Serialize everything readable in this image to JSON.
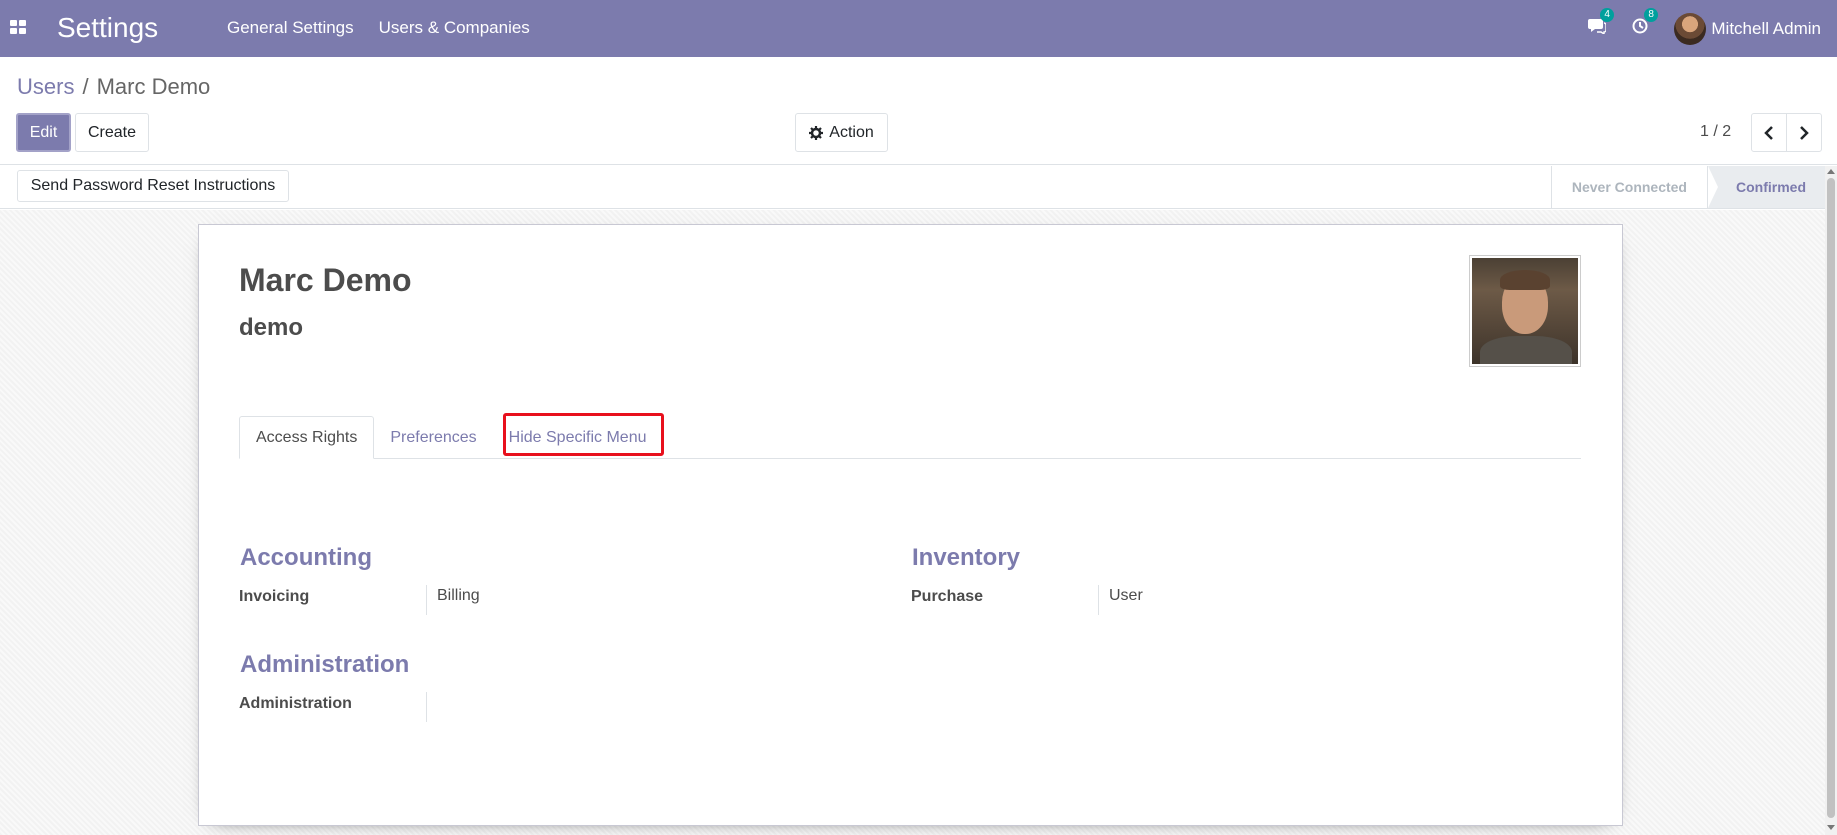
{
  "navbar": {
    "app_title": "Settings",
    "menu": [
      "General Settings",
      "Users & Companies"
    ],
    "messages_count": "4",
    "activities_count": "8",
    "user_name": "Mitchell Admin"
  },
  "breadcrumb": {
    "parent": "Users",
    "separator": "/",
    "current": "Marc Demo"
  },
  "buttons": {
    "edit": "Edit",
    "create": "Create",
    "action": "Action",
    "reset_password": "Send Password Reset Instructions"
  },
  "pager": {
    "value": "1 / 2"
  },
  "statusbar": {
    "stages": [
      "Never Connected",
      "Confirmed"
    ],
    "active": "Confirmed"
  },
  "record": {
    "name": "Marc Demo",
    "login": "demo"
  },
  "tabs": [
    "Access Rights",
    "Preferences",
    "Hide Specific Menu"
  ],
  "access_rights": {
    "accounting": {
      "title": "Accounting",
      "fields": [
        {
          "label": "Invoicing",
          "value": "Billing"
        }
      ]
    },
    "inventory": {
      "title": "Inventory",
      "fields": [
        {
          "label": "Purchase",
          "value": "User"
        }
      ]
    },
    "administration": {
      "title": "Administration",
      "fields": [
        {
          "label": "Administration",
          "value": ""
        }
      ]
    }
  },
  "colors": {
    "brand": "#7c7bad",
    "highlight": "#e8101d",
    "badge": "#00a09d"
  }
}
